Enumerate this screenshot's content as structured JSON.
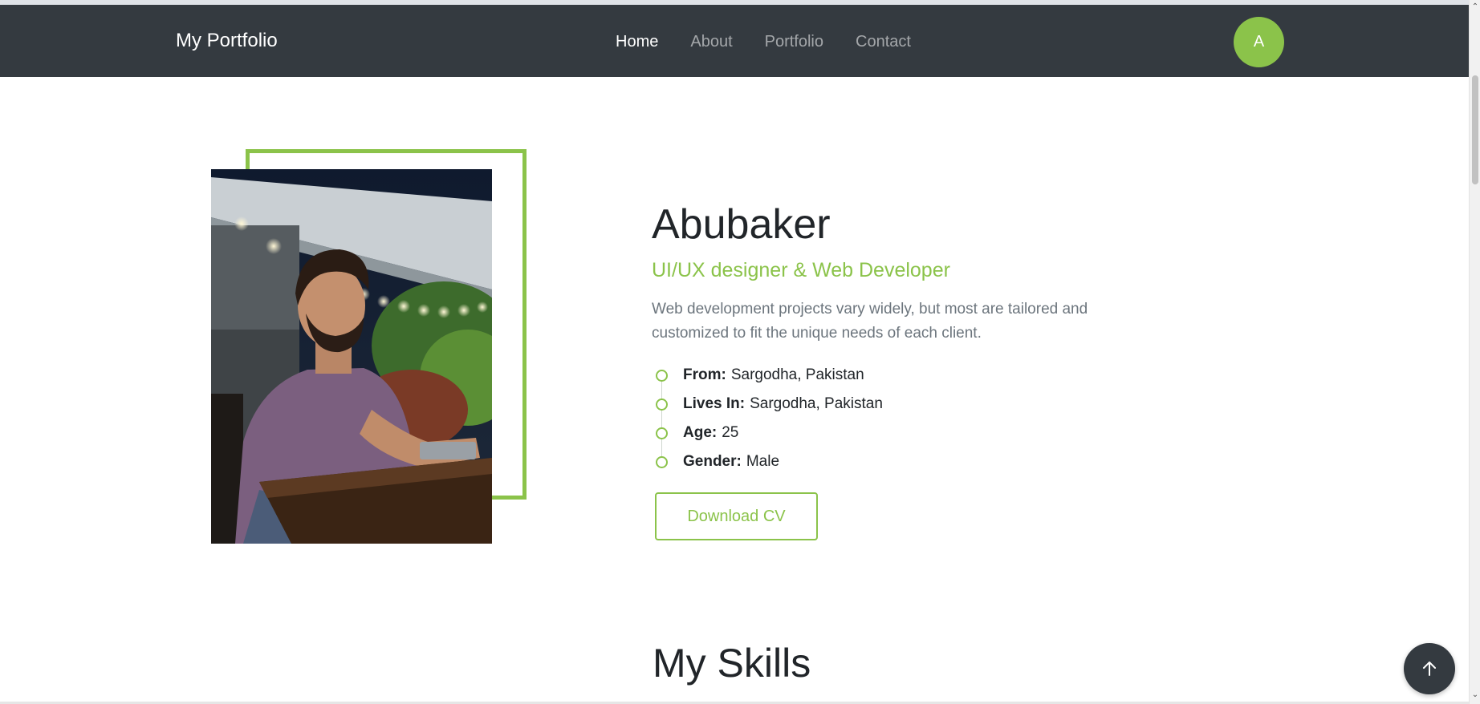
{
  "navbar": {
    "brand": "My Portfolio",
    "links": [
      {
        "label": "Home",
        "active": true
      },
      {
        "label": "About",
        "active": false
      },
      {
        "label": "Portfolio",
        "active": false
      },
      {
        "label": "Contact",
        "active": false
      }
    ],
    "avatar_initial": "A"
  },
  "profile": {
    "photo_alt": "profile-photo",
    "name": "Abubaker",
    "role": "UI/UX designer & Web Developer",
    "bio": "Web development projects vary widely, but most are tailored and customized to fit the unique needs of each client.",
    "details": [
      {
        "label": "From:",
        "value": "Sargodha, Pakistan"
      },
      {
        "label": "Lives In:",
        "value": "Sargodha, Pakistan"
      },
      {
        "label": "Age:",
        "value": "25"
      },
      {
        "label": "Gender:",
        "value": "Male"
      }
    ],
    "download_label": "Download CV"
  },
  "skills": {
    "title": "My Skills"
  },
  "icons": {
    "back_to_top": "arrow-up-icon",
    "timeline_marker": "circle-outline-icon"
  },
  "colors": {
    "navbar_bg": "#343a40",
    "accent": "#8bc34a",
    "text_dark": "#212529",
    "text_muted": "#6c757d"
  }
}
